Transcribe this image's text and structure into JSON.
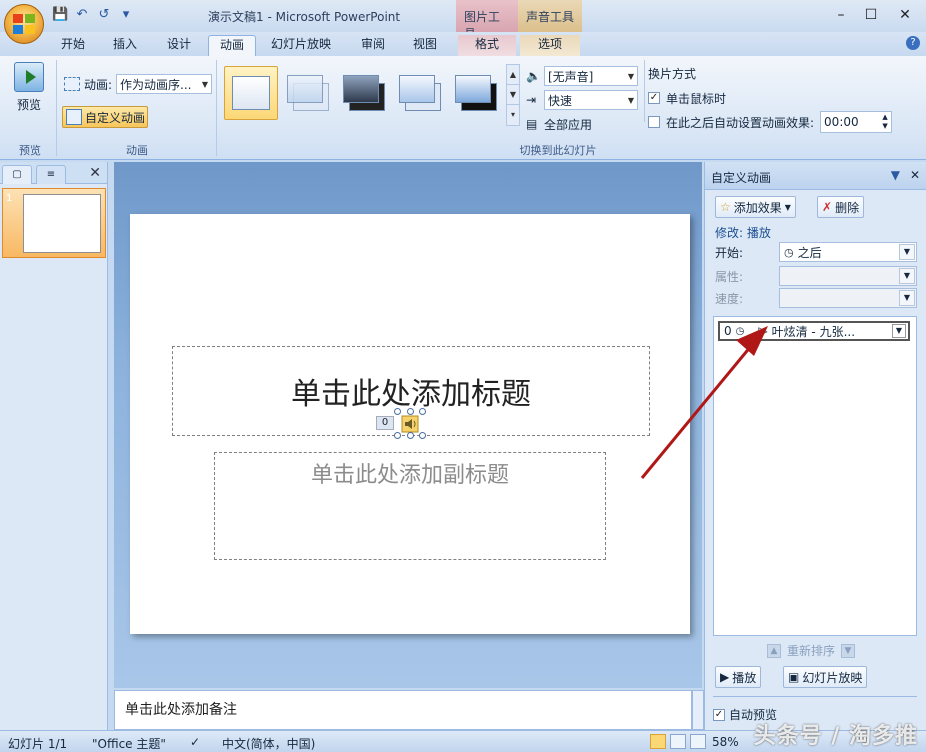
{
  "window": {
    "title": "演示文稿1 - Microsoft PowerPoint",
    "context_tab_picture": "图片工具",
    "context_tab_sound": "声音工具",
    "minimize": "–",
    "maximize": "☐",
    "close": "✕"
  },
  "qat": {
    "save": "💾",
    "undo": "↶",
    "redo": "↺",
    "more": "▾"
  },
  "tabs": [
    {
      "label": "开始"
    },
    {
      "label": "插入"
    },
    {
      "label": "设计"
    },
    {
      "label": "动画"
    },
    {
      "label": "幻灯片放映"
    },
    {
      "label": "审阅"
    },
    {
      "label": "视图"
    },
    {
      "label": "格式"
    },
    {
      "label": "选项"
    }
  ],
  "ribbon": {
    "preview_label": "预览",
    "preview_group": "预览",
    "animate_label": "动画:",
    "animate_value": "作为动画序...",
    "custom_anim_button": "自定义动画",
    "animation_group": "动画",
    "transition_group": "切换到此幻灯片",
    "sound_value": "[无声音]",
    "speed_value": "快速",
    "apply_all": "全部应用",
    "advance_title": "换片方式",
    "on_click": "单击鼠标时",
    "on_click_checked": "✓",
    "auto_after": "在此之后自动设置动画效果:",
    "auto_time": "00:00"
  },
  "slides_pane": {
    "close": "✕",
    "slide_number": "1",
    "tab_slides": "▢",
    "tab_outline": "≡"
  },
  "slide": {
    "title_placeholder": "单击此处添加标题",
    "subtitle_placeholder": "单击此处添加副标题",
    "sound_order": "0"
  },
  "notes": {
    "placeholder": "单击此处添加备注"
  },
  "task_pane": {
    "title": "自定义动画",
    "dropdown_btn": "▼",
    "close": "✕",
    "add_effect": "添加效果",
    "remove": "删除",
    "modify": "修改: 播放",
    "start_label": "开始:",
    "start_value": "之后",
    "property_label": "属性:",
    "speed_label": "速度:",
    "item_order": "0",
    "item_name": "叶炫清 - 九张...",
    "reorder": "重新排序",
    "play": "播放",
    "slideshow": "幻灯片放映",
    "autopreview": "自动预览"
  },
  "status": {
    "slide": "幻灯片 1/1",
    "theme": "\"Office 主题\"",
    "language": "中文(简体，中国)",
    "zoom": "58%"
  },
  "watermark": "头条号 / 淘多推",
  "colors": {
    "arrow": "#b01818",
    "accent": "#f8c65a"
  }
}
